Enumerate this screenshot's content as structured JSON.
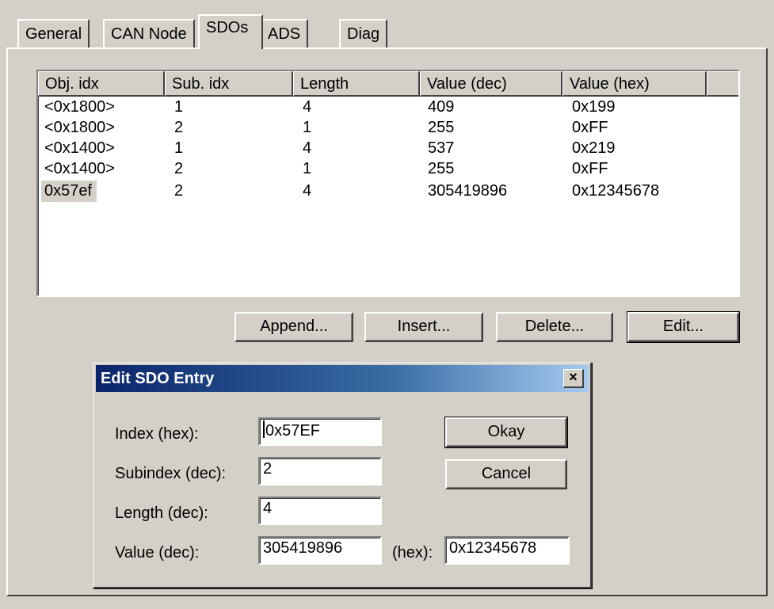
{
  "tabs": [
    {
      "label": "General",
      "active": false
    },
    {
      "label": "CAN Node",
      "active": false
    },
    {
      "label": "SDOs",
      "active": true
    },
    {
      "label": "ADS",
      "active": false
    },
    {
      "label": "Diag",
      "active": false
    }
  ],
  "sdo_list": {
    "columns": [
      "Obj. idx",
      "Sub. idx",
      "Length",
      "Value (dec)",
      "Value (hex)"
    ],
    "rows": [
      {
        "obj_idx": "<0x1800>",
        "sub_idx": "1",
        "length": "4",
        "value_dec": "409",
        "value_hex": "0x199"
      },
      {
        "obj_idx": "<0x1800>",
        "sub_idx": "2",
        "length": "1",
        "value_dec": "255",
        "value_hex": "0xFF"
      },
      {
        "obj_idx": "<0x1400>",
        "sub_idx": "1",
        "length": "4",
        "value_dec": "537",
        "value_hex": "0x219"
      },
      {
        "obj_idx": "<0x1400>",
        "sub_idx": "2",
        "length": "1",
        "value_dec": "255",
        "value_hex": "0xFF"
      },
      {
        "obj_idx": "0x57ef",
        "sub_idx": "2",
        "length": "4",
        "value_dec": "305419896",
        "value_hex": "0x12345678"
      }
    ]
  },
  "actions": {
    "append": "Append...",
    "insert": "Insert...",
    "delete": "Delete...",
    "edit": "Edit..."
  },
  "dialog": {
    "title": "Edit SDO Entry",
    "close_glyph": "×",
    "index_label": "Index (hex):",
    "index_value": "0x57EF",
    "subindex_label": "Subindex (dec):",
    "subindex_value": "2",
    "length_label": "Length (dec):",
    "length_value": "4",
    "value_label": "Value (dec):",
    "value_value": "305419896",
    "hex_label": "(hex):",
    "hex_value": "0x12345678",
    "okay": "Okay",
    "cancel": "Cancel"
  },
  "colors": {
    "face": "#d4d0c8",
    "titlebar_start": "#0a246a",
    "titlebar_end": "#a6caf0"
  }
}
